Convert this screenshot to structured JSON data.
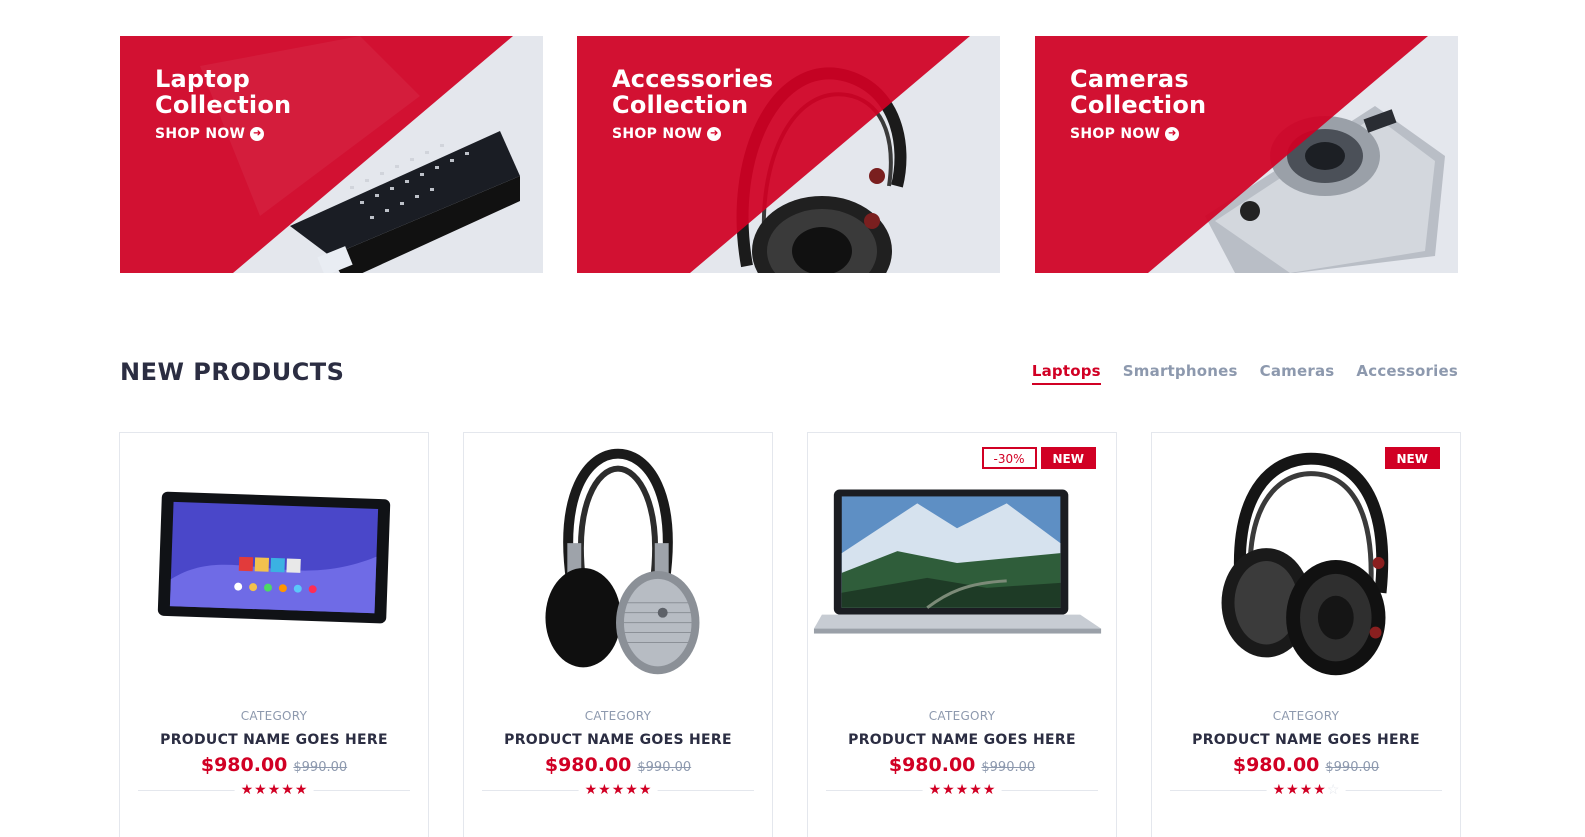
{
  "collections": [
    {
      "title_line1": "Laptop",
      "title_line2": "Collection",
      "cta": "SHOP NOW",
      "product_icon": "laptop-image"
    },
    {
      "title_line1": "Accessories",
      "title_line2": "Collection",
      "cta": "SHOP NOW",
      "product_icon": "headphones-image"
    },
    {
      "title_line1": "Cameras",
      "title_line2": "Collection",
      "cta": "SHOP NOW",
      "product_icon": "camera-image"
    }
  ],
  "section": {
    "title": "NEW PRODUCTS",
    "tabs": [
      {
        "label": "Laptops",
        "active": true
      },
      {
        "label": "Smartphones",
        "active": false
      },
      {
        "label": "Cameras",
        "active": false
      },
      {
        "label": "Accessories",
        "active": false
      }
    ]
  },
  "products": [
    {
      "category": "CATEGORY",
      "name": "PRODUCT NAME GOES HERE",
      "price": "$980.00",
      "old_price": "$990.00",
      "rating": 5,
      "sale_label": "",
      "new_label": "",
      "image_icon": "tablet-image"
    },
    {
      "category": "CATEGORY",
      "name": "PRODUCT NAME GOES HERE",
      "price": "$980.00",
      "old_price": "$990.00",
      "rating": 5,
      "sale_label": "",
      "new_label": "",
      "image_icon": "headphones-image"
    },
    {
      "category": "CATEGORY",
      "name": "PRODUCT NAME GOES HERE",
      "price": "$980.00",
      "old_price": "$990.00",
      "rating": 5,
      "sale_label": "-30%",
      "new_label": "NEW",
      "image_icon": "laptop-image"
    },
    {
      "category": "CATEGORY",
      "name": "PRODUCT NAME GOES HERE",
      "price": "$980.00",
      "old_price": "$990.00",
      "rating": 4,
      "sale_label": "",
      "new_label": "NEW",
      "image_icon": "headphones-image"
    }
  ],
  "colors": {
    "accent": "#d10024",
    "dark": "#2b2d42",
    "muted": "#8d99ae",
    "light_bg": "#e4e7ed"
  }
}
